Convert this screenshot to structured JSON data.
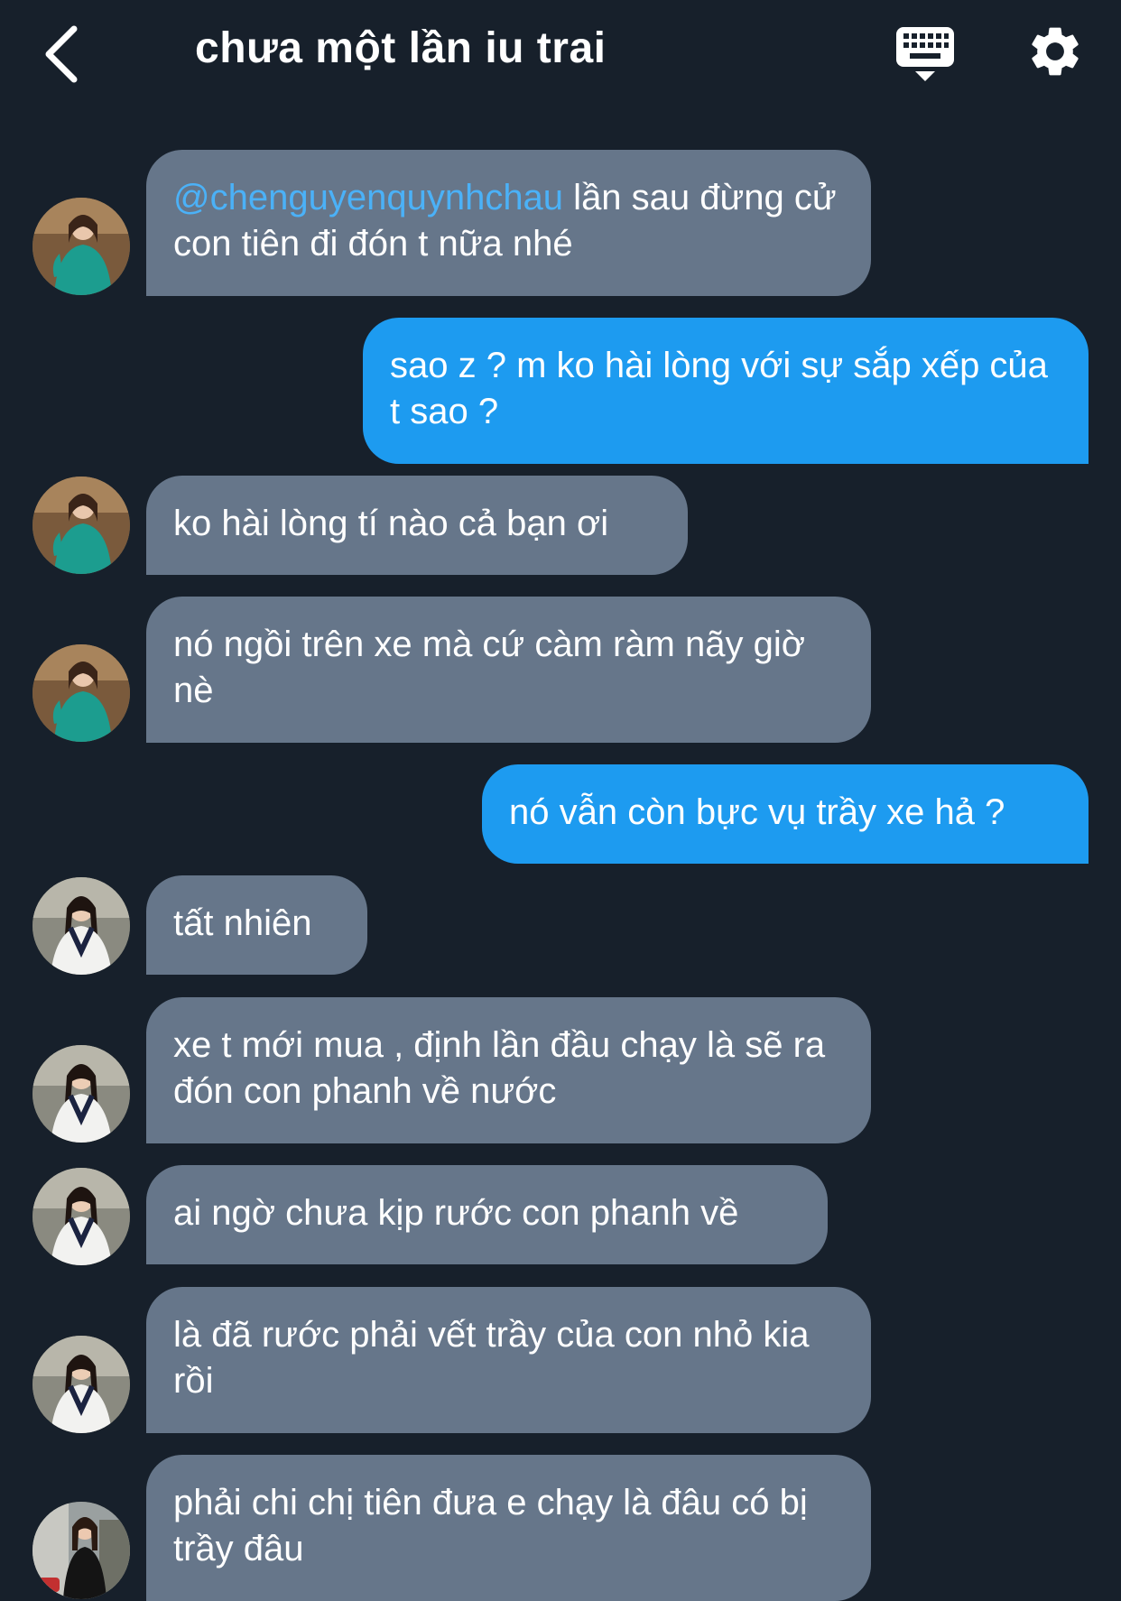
{
  "header": {
    "title": "chưa một lần iu trai",
    "back_icon": "chevron-left-icon",
    "keyboard_icon": "keyboard-icon",
    "settings_icon": "gear-icon"
  },
  "colors": {
    "background": "#17202b",
    "incoming_bubble": "#66768a",
    "outgoing_bubble": "#1d9bf0",
    "mention": "#4bb1f7"
  },
  "messages": [
    {
      "direction": "incoming",
      "avatar": "avatar-teal-dress",
      "mention": "@chenguyenquynhchau",
      "text": " lần sau đừng cử con tiên đi đón t nữa nhé"
    },
    {
      "direction": "outgoing",
      "text": "sao z ? m ko hài lòng với sự sắp xếp của t sao ?"
    },
    {
      "direction": "incoming",
      "avatar": "avatar-teal-dress",
      "text": "ko hài lòng tí nào cả bạn ơi"
    },
    {
      "direction": "incoming",
      "avatar": "avatar-teal-dress",
      "text": "nó ngồi trên xe mà cứ càm ràm nãy giờ nè"
    },
    {
      "direction": "outgoing",
      "text": "nó vẫn còn bực vụ trầy xe hả ?"
    },
    {
      "direction": "incoming",
      "avatar": "avatar-school-vest",
      "text": "tất nhiên"
    },
    {
      "direction": "incoming",
      "avatar": "avatar-school-vest",
      "text": "xe t mới mua , định lần đầu chạy là sẽ ra đón con phanh về nước"
    },
    {
      "direction": "incoming",
      "avatar": "avatar-school-vest",
      "text": "ai ngờ chưa kịp rước con phanh về"
    },
    {
      "direction": "incoming",
      "avatar": "avatar-school-vest",
      "text": "là đã rước phải vết trầy của con nhỏ kia rồi"
    },
    {
      "direction": "incoming",
      "avatar": "avatar-street",
      "text": "phải chi chị tiên đưa e chạy là đâu có bị trầy đâu"
    }
  ]
}
